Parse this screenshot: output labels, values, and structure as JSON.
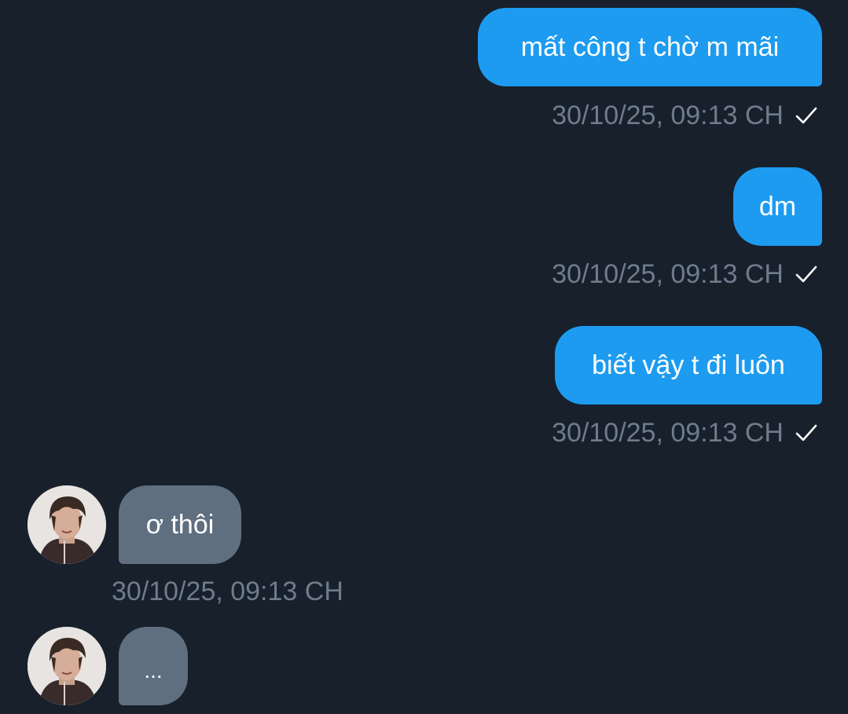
{
  "messages": [
    {
      "direction": "out",
      "text": "mất công t chờ m mãi",
      "time": "30/10/25, 09:13 CH",
      "status_icon": "check-icon"
    },
    {
      "direction": "out",
      "text": "dm",
      "time": "30/10/25, 09:13 CH",
      "status_icon": "check-icon"
    },
    {
      "direction": "out",
      "text": "biết vậy t đi luôn",
      "time": "30/10/25, 09:13 CH",
      "status_icon": "check-icon"
    },
    {
      "direction": "in",
      "text": "ơ thôi",
      "time": "30/10/25, 09:13 CH",
      "avatar": "contact-avatar"
    },
    {
      "direction": "in",
      "text": "...",
      "avatar": "contact-avatar",
      "typing": true
    }
  ],
  "colors": {
    "background": "#17202b",
    "outgoing_bubble": "#1d9bf0",
    "incoming_bubble": "#5f6f80",
    "timestamp": "#6e7c8d",
    "text": "#ffffff"
  }
}
